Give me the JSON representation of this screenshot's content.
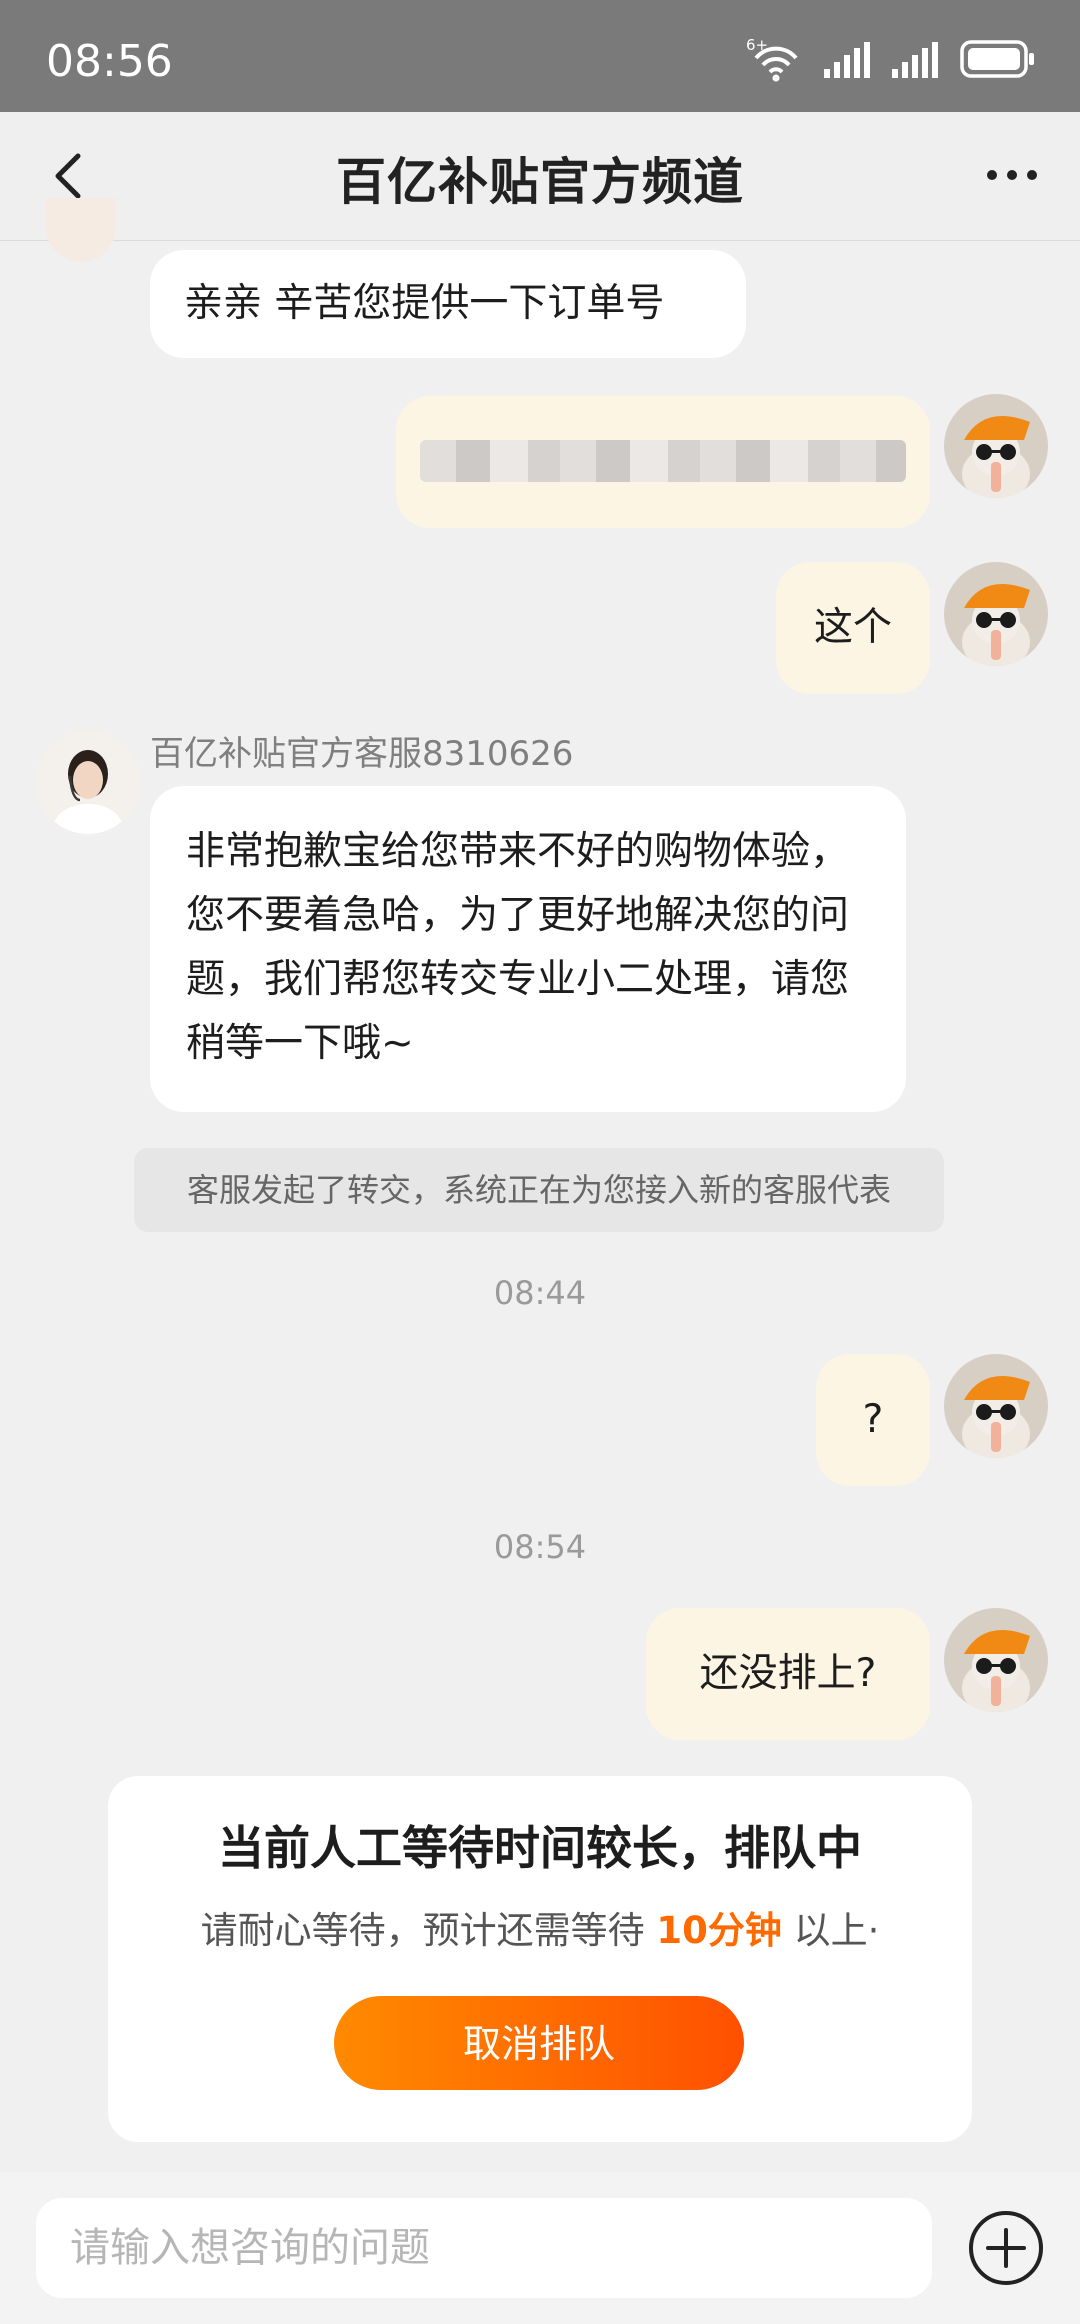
{
  "status_bar": {
    "time": "08:56",
    "network_label": "6+"
  },
  "header": {
    "title": "百亿补贴官方频道"
  },
  "messages": {
    "m1": "亲亲 辛苦您提供一下订单号",
    "m3": "这个",
    "agent_name": "百亿补贴官方客服8310626",
    "m4": "非常抱歉宝给您带来不好的购物体验，您不要着急哈，为了更好地解决您的问题，我们帮您转交专业小二处理，请您稍等一下哦~",
    "system": "客服发起了转交，系统正在为您接入新的客服代表",
    "time1": "08:44",
    "m5": "?",
    "time2": "08:54",
    "m6": "还没排上?"
  },
  "queue": {
    "title": "当前人工等待时间较长，排队中",
    "sub_prefix": "请耐心等待，预计还需等待 ",
    "sub_highlight": "10分钟",
    "sub_suffix": " 以上·",
    "cancel_label": "取消排队"
  },
  "input": {
    "placeholder": "请输入想咨询的问题"
  },
  "colors": {
    "accent": "#ff6a00",
    "user_bubble": "#fdf5e4",
    "agent_bubble": "#ffffff",
    "status_bar": "#7a7a7a"
  },
  "icons": [
    "back-arrow-icon",
    "more-dots-icon",
    "wifi-icon",
    "signal-icon",
    "battery-icon",
    "add-icon"
  ]
}
